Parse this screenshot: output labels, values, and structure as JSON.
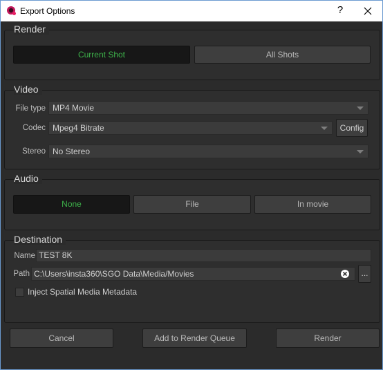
{
  "window": {
    "title": "Export Options",
    "help_glyph": "?",
    "close_glyph": "✕"
  },
  "render": {
    "title": "Render",
    "current_shot": "Current Shot",
    "all_shots": "All Shots",
    "selected": "Current Shot"
  },
  "video": {
    "title": "Video",
    "file_type_label": "File type",
    "file_type_value": "MP4 Movie",
    "codec_label": "Codec",
    "codec_value": "Mpeg4 Bitrate",
    "config_label": "Config",
    "stereo_label": "Stereo",
    "stereo_value": "No Stereo"
  },
  "audio": {
    "title": "Audio",
    "none": "None",
    "file": "File",
    "in_movie": "In movie",
    "selected": "None"
  },
  "destination": {
    "title": "Destination",
    "name_label": "Name",
    "name_value": "TEST 8K",
    "path_label": "Path",
    "path_value": "C:\\Users\\insta360\\SGO Data\\Media/Movies",
    "browse_label": "...",
    "inject_label": "Inject Spatial Media Metadata",
    "inject_checked": false
  },
  "footer": {
    "cancel": "Cancel",
    "add_to_queue": "Add to Render Queue",
    "render": "Render"
  },
  "colors": {
    "accent_green": "#3db24a",
    "background": "#2b2b2b",
    "button": "#3e3e3e",
    "active_button": "#171717"
  },
  "icons": {
    "app": "app-logo-icon",
    "close": "close-icon",
    "clear": "clear-x-icon",
    "dropdown": "chevron-down-icon"
  }
}
